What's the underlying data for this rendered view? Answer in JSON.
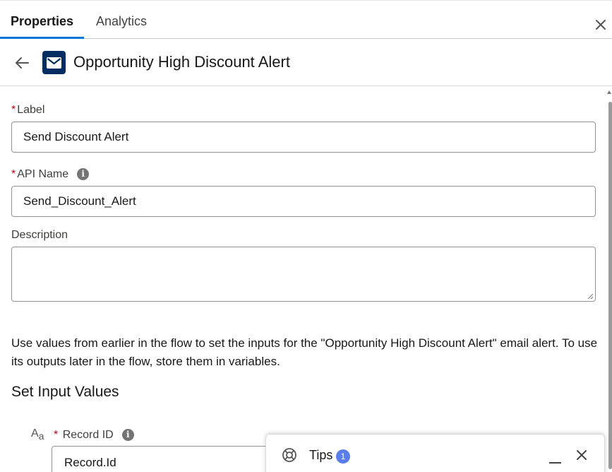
{
  "tabs": [
    {
      "label": "Properties",
      "active": true
    },
    {
      "label": "Analytics",
      "active": false
    }
  ],
  "header": {
    "title": "Opportunity High Discount Alert",
    "icon": "email-icon",
    "icon_bg": "#032d60"
  },
  "fields": {
    "label": {
      "label": "Label",
      "required_mark": "*",
      "value": "Send Discount Alert"
    },
    "api_name": {
      "label": "API Name",
      "required_mark": "*",
      "value": "Send_Discount_Alert",
      "info": "i"
    },
    "description": {
      "label": "Description",
      "value": ""
    }
  },
  "help_text": "Use values from earlier in the flow to set the inputs for the \"Opportunity High Discount Alert\" email alert. To use its outputs later in the flow, store them in variables.",
  "inputs_section": {
    "title": "Set Input Values",
    "record_id": {
      "type_icon": "A",
      "type_icon_sub": "a",
      "required_mark": "*",
      "label": "Record ID",
      "info": "i",
      "value": "Record.Id"
    }
  },
  "tips": {
    "label": "Tips",
    "badge": "1"
  },
  "colors": {
    "accent": "#0176d3",
    "required": "#ba0517",
    "badge": "#5a7dea"
  }
}
